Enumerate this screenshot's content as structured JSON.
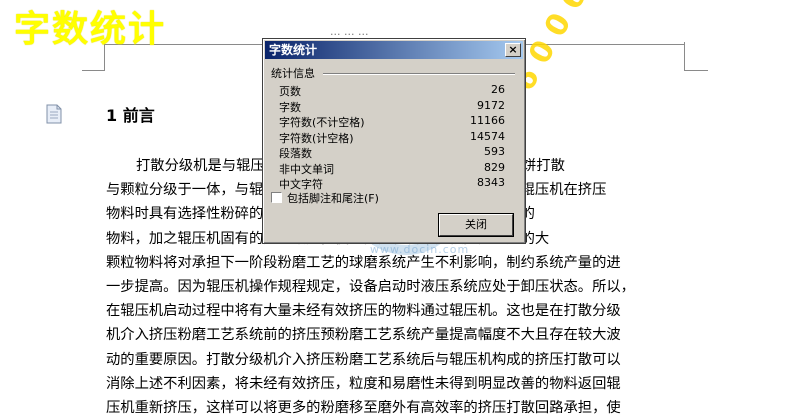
{
  "overlay": {
    "title": "字数统计"
  },
  "document": {
    "header_text": "··· ··· ···",
    "heading": "1 前言",
    "lines": [
      "打散分级机是与辊压机配套使用的新型分级设备，该设备集料饼打散",
      "与颗粒分级于一体，与辊压机配套使用。本设备所处于的路。由于辊压机在挤压",
      "物料时具有选择性粉碎的特点，挤压后的物料中仍有少量未挤压好的",
      "物料，加之辊压机固有的边缘效应，使得部分物料未能被充分挤压的大",
      "颗粒物料将对承担下一阶段粉磨工艺的球磨系统产生不利影响，制约系统产量的进",
      "一步提高。因为辊压机操作规程规定，设备启动时液压系统应处于卸压状态。所以，",
      "在辊压机启动过程中将有大量未经有效挤压的物料通过辊压机。这也是在打散分级",
      "机介入挤压粉磨工艺系统前的挤压预粉磨工艺系统产量提高幅度不大且存在较大波",
      "动的重要原因。打散分级机介入挤压粉磨工艺系统后与辊压机构成的挤压打散可以",
      "消除上述不利因素，将未经有效挤压，粒度和易磨性未得到明显改善的物料返回辊",
      "压机重新挤压，这样可以将更多的粉磨移至磨外有高效率的挤压打散回路承担，使"
    ]
  },
  "watermark": {
    "brand": "文库",
    "url": "www.docin.com",
    "phone": "QQ 7 6 0 0 6 6 8"
  },
  "dialog": {
    "title": "字数统计",
    "close_glyph": "×",
    "group_label": "统计信息",
    "stats": [
      {
        "label": "页数",
        "value": "26"
      },
      {
        "label": "字数",
        "value": "9172"
      },
      {
        "label": "字符数(不计空格)",
        "value": "11166"
      },
      {
        "label": "字符数(计空格)",
        "value": "14574"
      },
      {
        "label": "段落数",
        "value": "593"
      },
      {
        "label": "非中文单词",
        "value": "829"
      },
      {
        "label": "中文字符",
        "value": "8343"
      }
    ],
    "checkbox_label": "包括脚注和尾注(F)",
    "close_button": "关闭"
  }
}
